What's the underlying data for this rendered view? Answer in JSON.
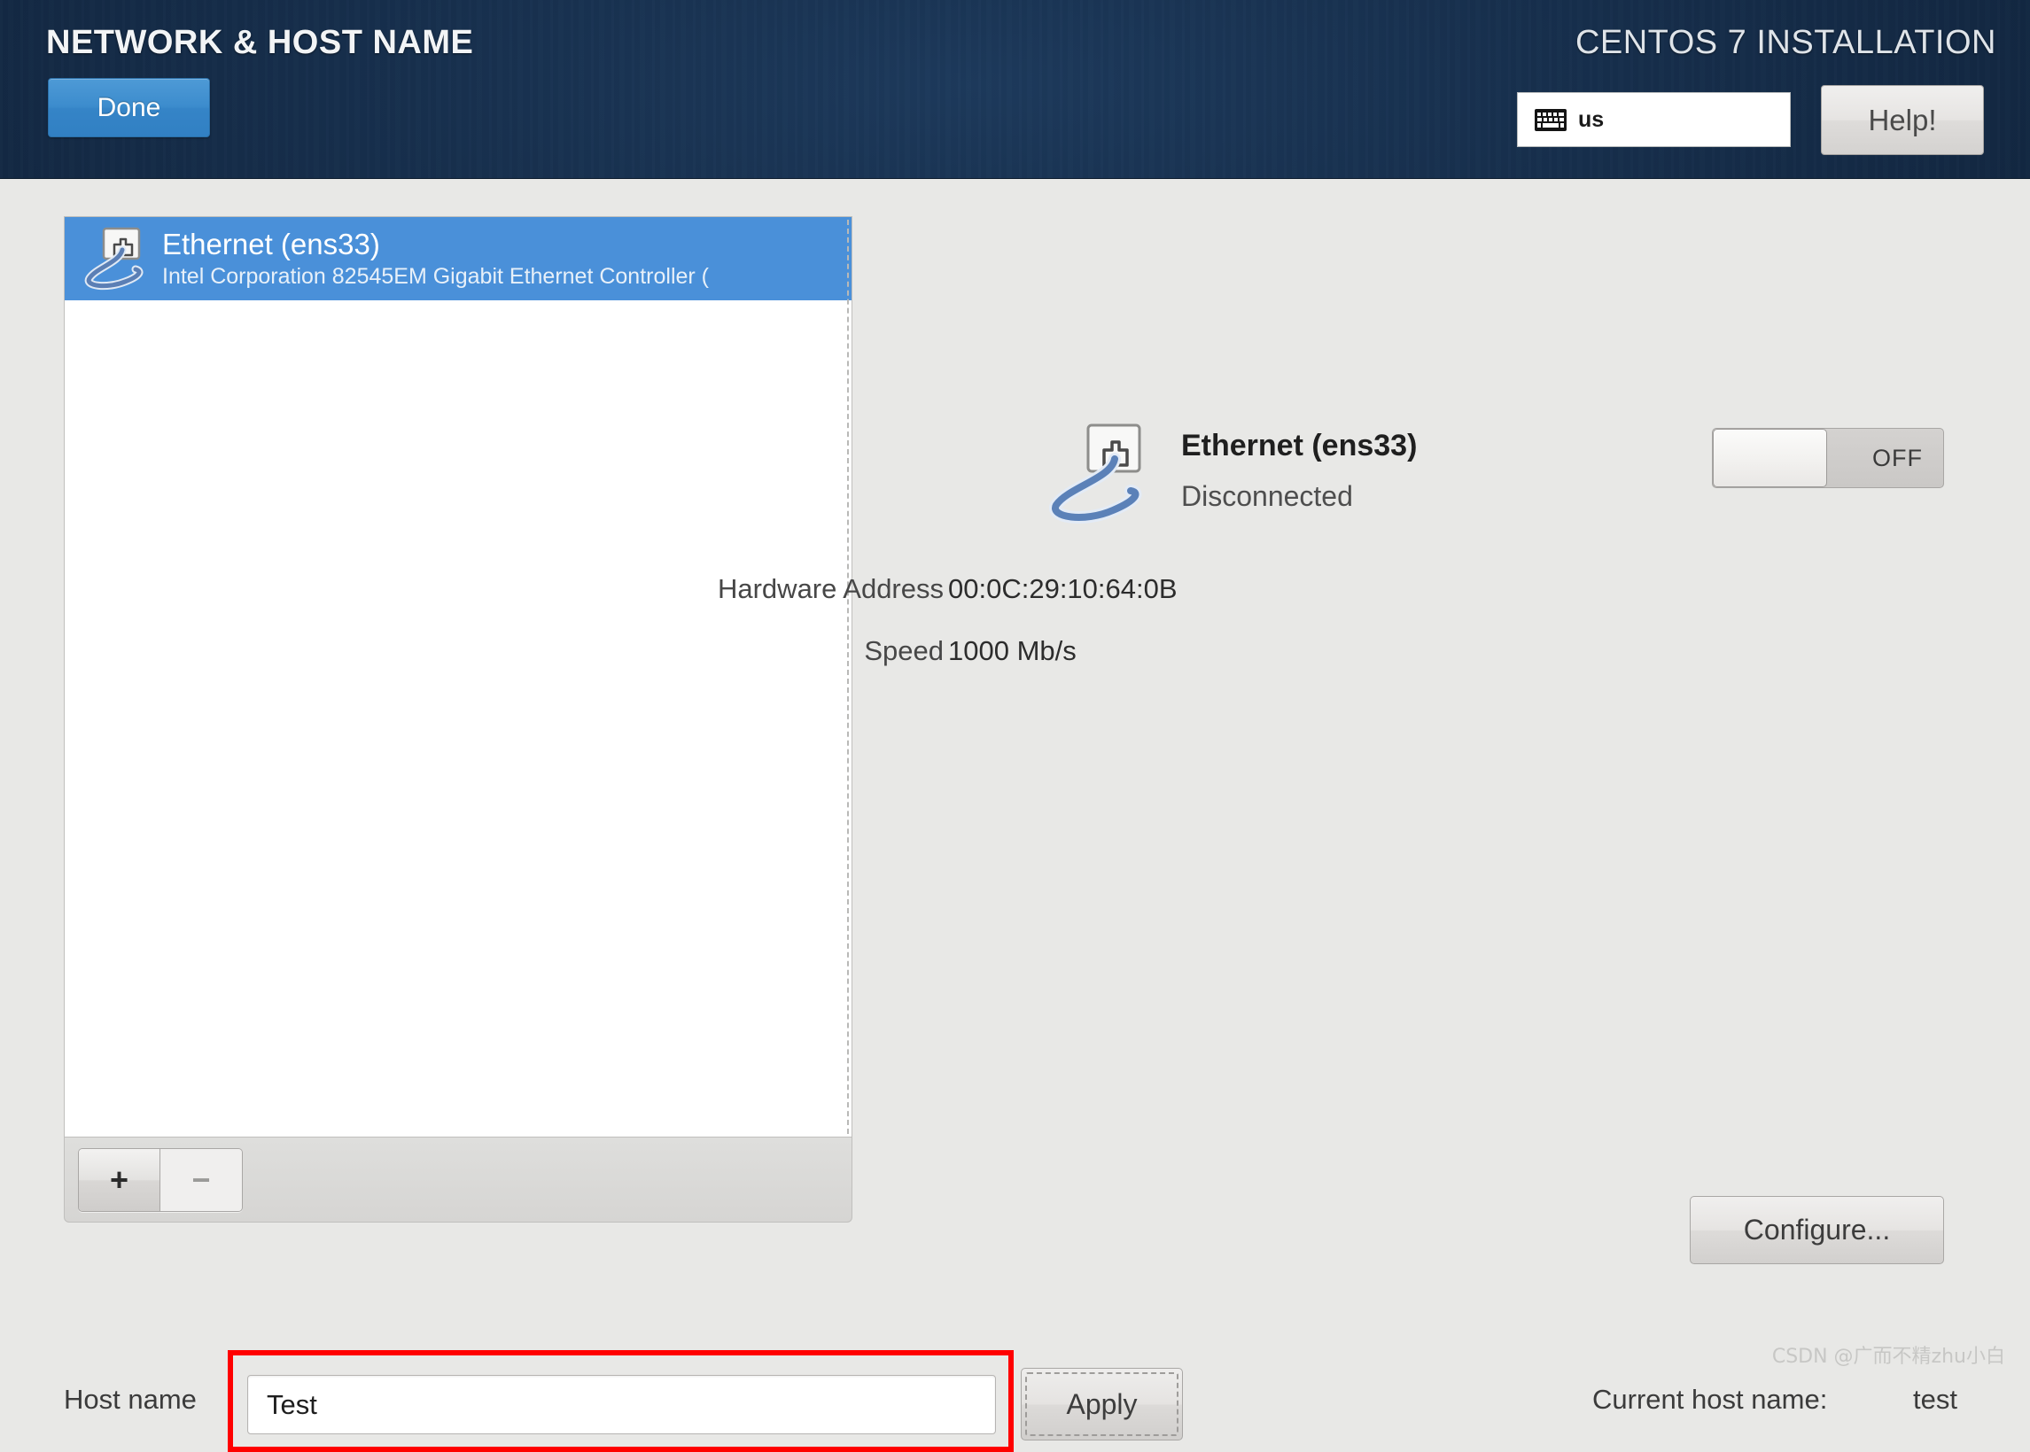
{
  "header": {
    "title": "NETWORK & HOST NAME",
    "done_label": "Done",
    "install_label": "CENTOS 7 INSTALLATION",
    "keyboard_layout": "us",
    "keyboard_icon": "keyboard-icon",
    "help_label": "Help!"
  },
  "device_list": {
    "items": [
      {
        "icon": "wired-network-icon",
        "name": "Ethernet (ens33)",
        "description": "Intel Corporation 82545EM Gigabit Ethernet Controller (",
        "selected": true
      }
    ],
    "add_label": "+",
    "remove_label": "−"
  },
  "detail": {
    "icon": "wired-network-icon",
    "name": "Ethernet (ens33)",
    "status": "Disconnected",
    "fields": [
      {
        "label": "Hardware Address",
        "value": "00:0C:29:10:64:0B"
      },
      {
        "label": "Speed",
        "value": "1000 Mb/s"
      }
    ],
    "toggle_state": "OFF",
    "configure_label": "Configure..."
  },
  "hostname": {
    "label": "Host name",
    "value": "Test",
    "apply_label": "Apply",
    "current_label": "Current host name:",
    "current_value": "test",
    "highlight_color": "#ff0000"
  },
  "watermark": "CSDN @广而不精zhu小白",
  "colors": {
    "header_bg": "#17304e",
    "accent_blue": "#3c8ccd",
    "selection_blue": "#4a90d9",
    "page_bg": "#e8e8e6"
  }
}
